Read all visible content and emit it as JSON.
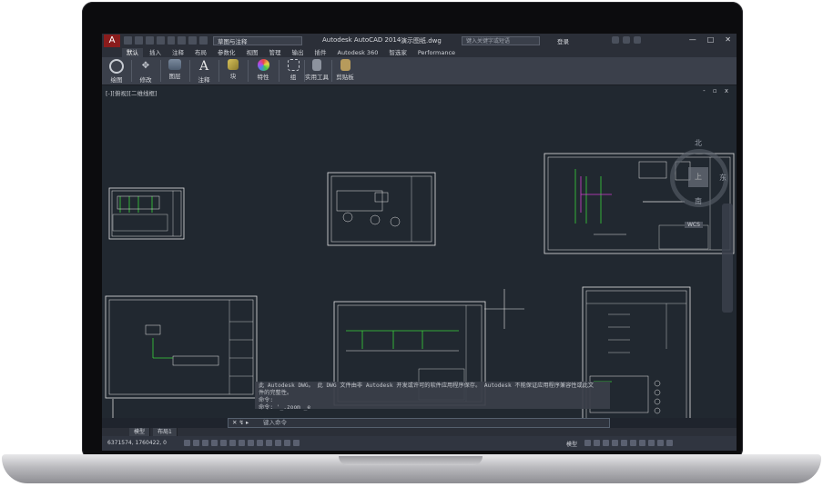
{
  "window": {
    "app_title": "Autodesk AutoCAD 2014",
    "file_title": "演示图纸.dwg",
    "workspace": "草图与注释",
    "search_placeholder": "键入关键字或短语",
    "signin": "登录",
    "controls": [
      "—",
      "□",
      "✕"
    ]
  },
  "ribbon": {
    "tabs": [
      "默认",
      "插入",
      "注释",
      "布局",
      "参数化",
      "视图",
      "管理",
      "输出",
      "插件",
      "Autodesk 360",
      "智选家",
      "Performance"
    ],
    "active_tab": "默认",
    "tools": [
      "绘图",
      "修改",
      "图层",
      "注释",
      "块",
      "特性",
      "组",
      "实用工具",
      "剪贴板"
    ]
  },
  "viewport": {
    "label": "[-][俯视][二维线框]",
    "controls": "- ▫ x",
    "viewcube": {
      "north": "北",
      "east": "东",
      "south": "南",
      "face": "上",
      "wcs": "WCS"
    }
  },
  "command": {
    "history": [
      "此 Autodesk DWG。 此 DWG 文件由非 Autodesk 开发或许可的软件应用程序保存。 Autodesk 不能保证应用程序兼容性或此文",
      "件的完整性。",
      "命令:",
      "命令: '_.zoom _e"
    ],
    "prompt": "键入命令"
  },
  "layout_tabs": [
    "模型",
    "布局1"
  ],
  "status": {
    "coordinates": "6371574, 1760422, 0",
    "model_label": "模型"
  },
  "colors": {
    "accent": "#8a1c1c",
    "canvas": "#212830",
    "line_white": "#e8e8e8",
    "line_green": "#38d43a",
    "line_magenta": "#d23fd2"
  }
}
